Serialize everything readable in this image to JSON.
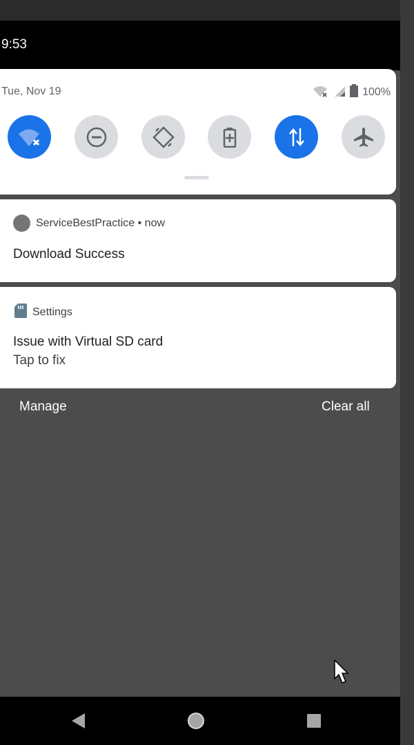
{
  "status_bar": {
    "time": "9:53"
  },
  "quick_settings": {
    "date": "Tue, Nov 19",
    "battery": "100%",
    "tiles": [
      {
        "icon": "wifi-off-icon",
        "active": true
      },
      {
        "icon": "do-not-disturb-icon",
        "active": false
      },
      {
        "icon": "auto-rotate-icon",
        "active": false
      },
      {
        "icon": "battery-saver-icon",
        "active": false
      },
      {
        "icon": "mobile-data-icon",
        "active": true
      },
      {
        "icon": "airplane-icon",
        "active": false
      }
    ]
  },
  "notifications": [
    {
      "app": "ServiceBestPractice",
      "time_sep": " • ",
      "time": "now",
      "title": "Download Success"
    },
    {
      "app": "Settings",
      "title": "Issue with Virtual SD card",
      "text": "Tap to fix"
    }
  ],
  "footer": {
    "manage": "Manage",
    "clear_all": "Clear all"
  },
  "colors": {
    "accent": "#1a73e8",
    "tile_inactive": "#dadce0",
    "shade_background": "#4c4c4c"
  }
}
